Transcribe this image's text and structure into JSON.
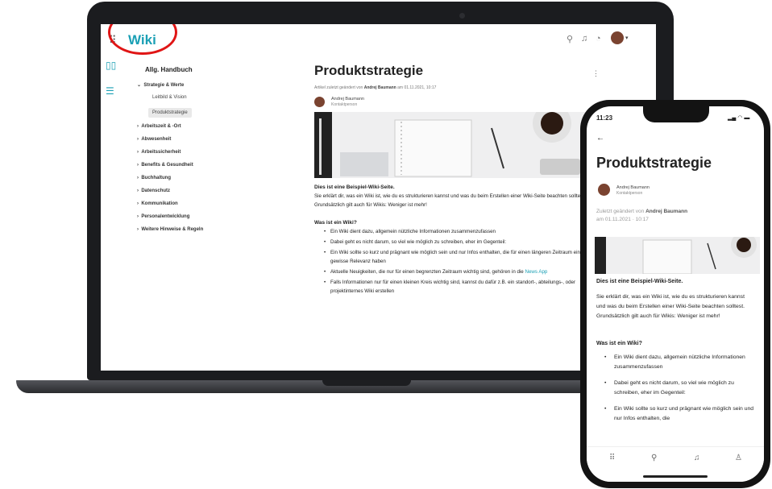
{
  "app": {
    "name": "Wiki"
  },
  "sidebar": {
    "title": "Allg. Handbuch",
    "section_open": "Strategie & Werte",
    "sub_items": [
      "Leitbild & Vision",
      "Produktstrategie"
    ],
    "items": [
      "Arbeitszeit & -Ort",
      "Abwesenheit",
      "Arbeitssicherheit",
      "Benefits & Gesundheit",
      "Buchhaltung",
      "Datenschutz",
      "Kommunikation",
      "Personalentwicklung",
      "Weitere Hinweise & Regeln"
    ]
  },
  "article": {
    "title": "Produktstrategie",
    "meta_prefix": "Artikel zuletzt geändert von",
    "meta_author": "Andrej Baumann",
    "meta_suffix": "am 01.11.2021, 10:17",
    "author": "Andrej Baumann",
    "role": "Kontaktperson",
    "intro_bold": "Dies ist eine Beispiel-Wiki-Seite.",
    "intro": "Sie erklärt dir, was ein Wiki ist, wie du es strukturieren kannst und was du beim Erstellen einer Wiki-Seite beachten solltest. Grundsätzlich gilt auch für Wikis: Weniger ist mehr!",
    "section": "Was ist ein Wiki?",
    "bullets": [
      "Ein Wiki dient dazu, allgemein nützliche Informationen zusammenzufassen",
      "Dabei geht es nicht darum, so viel wie möglich zu schreiben, eher im Gegenteil:",
      "Ein Wiki sollte so kurz und prägnant wie möglich sein und nur Infos enthalten, die für einen längeren Zeitraum eine gewisse Relevanz haben",
      "Aktuelle Neuigkeiten, die nur für einen begrenzten Zeitraum wichtig sind, gehören in die",
      "Falls Informationen nur für einen kleinen Kreis wichtig sind, kannst du dafür z.B. ein standort-, abteilungs-, oder projektinternes Wiki erstellen"
    ],
    "news_link": "News App"
  },
  "phone": {
    "time": "11:23",
    "title": "Produktstrategie",
    "author": "Andrej Baumann",
    "role": "Kontaktperson",
    "meta_prefix": "Zuletzt geändert von",
    "meta_author": "Andrej Baumann",
    "meta_date": "am 01.11.2021 · 10:17",
    "intro_bold": "Dies ist eine Beispiel-Wiki-Seite.",
    "intro": "Sie erklärt dir, was ein Wiki ist, wie du es strukturieren kannst und was du beim Erstellen einer Wiki-Seite beachten solltest. Grundsätzlich gilt auch für Wikis: Weniger ist mehr!",
    "section": "Was ist ein Wiki?",
    "bullets": [
      "Ein Wiki dient dazu, allgemein nützliche Informationen zusammenzufassen",
      "Dabei geht es nicht darum, so viel wie möglich zu schreiben, eher im Gegenteil:",
      "Ein Wiki sollte so kurz und prägnant wie möglich sein und nur Infos enthalten, die"
    ]
  },
  "colors": {
    "accent": "#1ba0b5",
    "highlight_ring": "#e01515"
  },
  "icons": [
    "grid-icon",
    "book-icon",
    "list-icon",
    "search-icon",
    "bell-icon",
    "chat-icon",
    "more-icon",
    "back-arrow-icon",
    "home-grid-icon",
    "person-icon"
  ]
}
